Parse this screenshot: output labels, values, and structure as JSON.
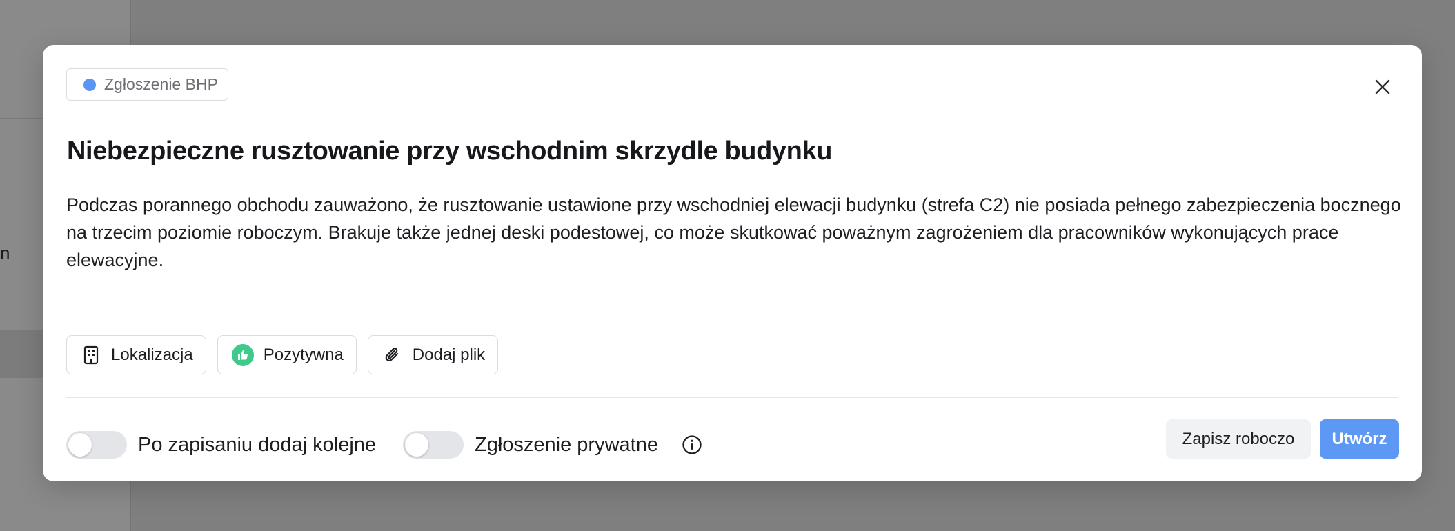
{
  "background": {
    "fragment_text": "n"
  },
  "modal": {
    "tag": {
      "label": "Zgłoszenie BHP",
      "dot_color": "#5b95f5"
    },
    "close_icon": "close-icon",
    "title": "Niebezpieczne rusztowanie przy wschodnim skrzydle budynku",
    "description": "Podczas porannego obchodu zauważono, że rusztowanie ustawione przy wschodniej elewacji budynku (strefa C2) nie posiada pełnego zabezpieczenia bocznego na trzecim poziomie roboczym. Brakuje także jednej deski podestowej, co może skutkować poważnym zagrożeniem dla pracowników wykonujących prace elewacyjne.",
    "chips": [
      {
        "label": "Lokalizacja",
        "icon": "building-icon"
      },
      {
        "label": "Pozytywna",
        "icon": "thumbs-up-icon",
        "icon_color": "#3fc98a"
      },
      {
        "label": "Dodaj plik",
        "icon": "paperclip-icon"
      }
    ],
    "footer": {
      "toggle_add_next": {
        "label": "Po zapisaniu dodaj kolejne",
        "on": false
      },
      "toggle_private": {
        "label": "Zgłoszenie prywatne",
        "on": false
      },
      "info_icon": "info-icon",
      "draft_button": "Zapisz roboczo",
      "create_button": "Utwórz",
      "accent_color": "#5c98f4"
    }
  }
}
